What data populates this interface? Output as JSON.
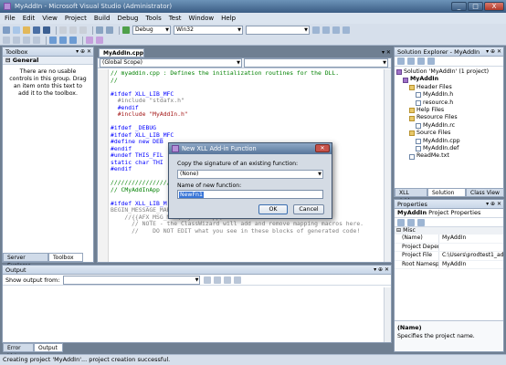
{
  "window": {
    "title": "MyAddIn - Microsoft Visual Studio (Administrator)",
    "minimize": "_",
    "maximize": "□",
    "close": "X"
  },
  "menu": [
    "File",
    "Edit",
    "View",
    "Project",
    "Build",
    "Debug",
    "Tools",
    "Test",
    "Window",
    "Help"
  ],
  "toolbar": {
    "configuration": "Debug",
    "platform": "Win32"
  },
  "toolbox": {
    "title": "Toolbox",
    "group": "General",
    "empty_message": "There are no usable controls in this group. Drag an item onto this text to add it to the toolbox.",
    "tab_server_explorer": "Server Explorer",
    "tab_toolbox": "Toolbox"
  },
  "editor": {
    "tab": "MyAddIn.cpp",
    "scope": "(Global Scope)",
    "member": "",
    "lines": [
      {
        "t": "// myaddin.cpp : Defines the initialization routines for the DLL.",
        "c": "c-cmt"
      },
      {
        "t": "//",
        "c": "c-cmt"
      },
      {
        "t": "",
        "c": "c-blk"
      },
      {
        "t": "#ifdef XLL_LIB_MFC",
        "c": "c-pp"
      },
      {
        "t": "  #include \"stdafx.h\"",
        "c": "c-gray"
      },
      {
        "t": "  #endif",
        "c": "c-pp"
      },
      {
        "t": "  #include \"MyAddIn.h\"",
        "c": "c-str"
      },
      {
        "t": "",
        "c": "c-blk"
      },
      {
        "t": "#ifdef _DEBUG",
        "c": "c-pp"
      },
      {
        "t": "#ifdef XLL_LIB_MFC",
        "c": "c-pp"
      },
      {
        "t": "#define new DEB",
        "c": "c-pp"
      },
      {
        "t": "#endif",
        "c": "c-pp"
      },
      {
        "t": "#undef THIS_FIL",
        "c": "c-pp"
      },
      {
        "t": "static char THI",
        "c": "c-pp"
      },
      {
        "t": "#endif",
        "c": "c-pp"
      },
      {
        "t": "",
        "c": "c-blk"
      },
      {
        "t": "////////////////////",
        "c": "c-cmt"
      },
      {
        "t": "// CMyAddInApp",
        "c": "c-cmt"
      },
      {
        "t": "",
        "c": "c-blk"
      },
      {
        "t": "#ifdef XLL_LIB_M",
        "c": "c-pp"
      },
      {
        "t": "BEGIN_MESSAGE_MAP(CMyAddInApp, CWinApp)",
        "c": "c-gray"
      },
      {
        "t": "    //{{AFX_MSG_MAP(CMyAddInApp)",
        "c": "c-gray"
      },
      {
        "t": "      // NOTE - the ClassWizard will add and remove mapping macros here.",
        "c": "c-gray"
      },
      {
        "t": "      //    DO NOT EDIT what you see in these blocks of generated code!",
        "c": "c-gray"
      }
    ]
  },
  "solution_explorer": {
    "title": "Solution Explorer - MyAddIn",
    "items": [
      {
        "label": "Solution 'MyAddIn' (1 project)",
        "level": 0,
        "icon": "solution"
      },
      {
        "label": "MyAddIn",
        "level": 1,
        "icon": "project"
      },
      {
        "label": "Header Files",
        "level": 2,
        "icon": "folder"
      },
      {
        "label": "MyAddIn.h",
        "level": 3,
        "icon": "file"
      },
      {
        "label": "resource.h",
        "level": 3,
        "icon": "file"
      },
      {
        "label": "Help Files",
        "level": 2,
        "icon": "folder"
      },
      {
        "label": "Resource Files",
        "level": 2,
        "icon": "folder"
      },
      {
        "label": "MyAddIn.rc",
        "level": 3,
        "icon": "file"
      },
      {
        "label": "Source Files",
        "level": 2,
        "icon": "folder"
      },
      {
        "label": "MyAddIn.cpp",
        "level": 3,
        "icon": "file"
      },
      {
        "label": "MyAddIn.def",
        "level": 3,
        "icon": "file"
      },
      {
        "label": "ReadMe.txt",
        "level": 2,
        "icon": "file"
      }
    ],
    "tabs": [
      "XLL Add...",
      "Solution ...",
      "Class View"
    ]
  },
  "properties": {
    "title": "Properties",
    "object": "MyAddIn",
    "object_type": "Project Properties",
    "category": "Misc",
    "rows": [
      {
        "k": "(Name)",
        "v": "MyAddIn"
      },
      {
        "k": "Project Dependen",
        "v": ""
      },
      {
        "k": "Project File",
        "v": "C:\\Users\\prodtest1_adi\\"
      },
      {
        "k": "Root Namespace",
        "v": "MyAddIn"
      }
    ],
    "desc_title": "(Name)",
    "desc_text": "Specifies the project name."
  },
  "output": {
    "title": "Output",
    "show_from_label": "Show output from:",
    "show_from_value": "",
    "tab_error_list": "Error List",
    "tab_output": "Output"
  },
  "dialog": {
    "title": "New XLL Add-in Function",
    "copy_label": "Copy the signature of an existing function:",
    "copy_value": "(None)",
    "name_label": "Name of new function:",
    "name_value": "NewFn1",
    "ok": "OK",
    "cancel": "Cancel"
  },
  "status": {
    "text": "Creating project 'MyAddIn'... project creation successful."
  },
  "colors": {
    "title_bar": "#3b5d84",
    "chrome": "#d6dfeb",
    "comment": "#008000",
    "preprocessor": "#0000ff"
  }
}
